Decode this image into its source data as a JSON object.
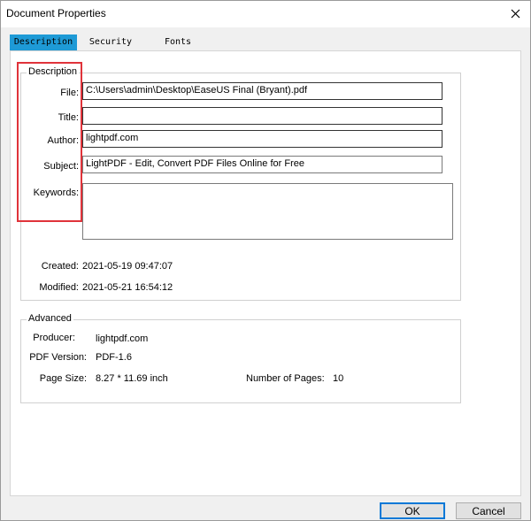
{
  "window": {
    "title": "Document Properties"
  },
  "tabs": [
    {
      "label": "Description",
      "active": true
    },
    {
      "label": "Security",
      "active": false
    },
    {
      "label": "Fonts",
      "active": false
    }
  ],
  "description": {
    "legend": "Description",
    "file_label": "File:",
    "file_value": "C:\\Users\\admin\\Desktop\\EaseUS Final (Bryant).pdf",
    "title_label": "Title:",
    "title_value": "",
    "author_label": "Author:",
    "author_value": "lightpdf.com",
    "subject_label": "Subject:",
    "subject_value": "LightPDF - Edit, Convert PDF Files Online for Free",
    "keywords_label": "Keywords:",
    "keywords_value": "",
    "created_label": "Created:",
    "created_value": "2021-05-19 09:47:07",
    "modified_label": "Modified:",
    "modified_value": "2021-05-21 16:54:12"
  },
  "advanced": {
    "legend": "Advanced",
    "producer_label": "Producer:",
    "producer_value": "lightpdf.com",
    "version_label": "PDF Version:",
    "version_value": "PDF-1.6",
    "pagesize_label": "Page Size:",
    "pagesize_value": "8.27 * 11.69 inch",
    "pages_label": "Number of Pages:",
    "pages_value": "10"
  },
  "buttons": {
    "ok": "OK",
    "cancel": "Cancel"
  },
  "colors": {
    "active_tab": "#1e9ad6",
    "highlight": "#e0333a",
    "default_button_border": "#0078d7"
  }
}
